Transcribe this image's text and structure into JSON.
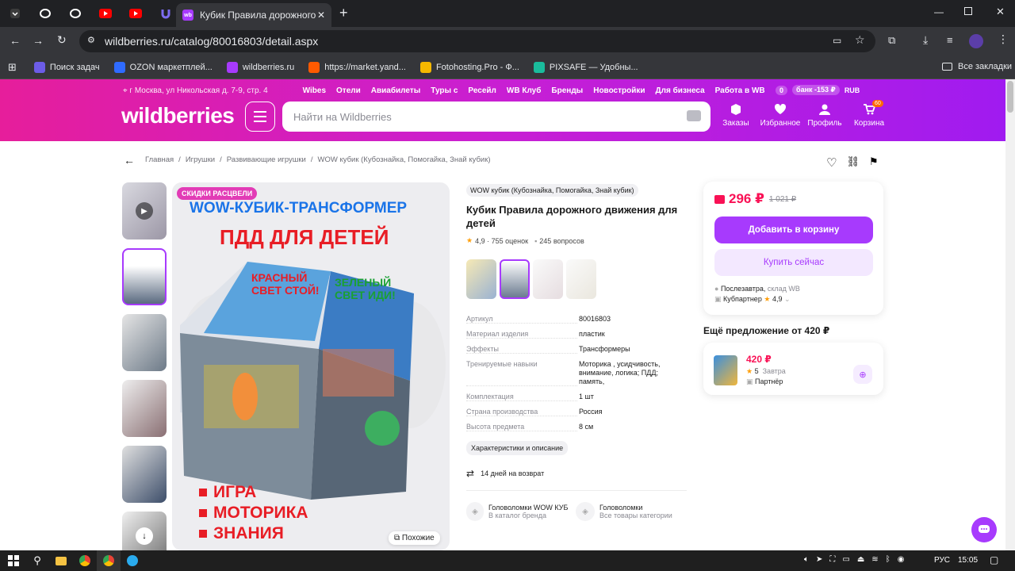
{
  "browser": {
    "active_tab_title": "Кубик Правила дорожного дв",
    "url": "wildberries.ru/catalog/80016803/detail.aspx",
    "bookmarks": [
      {
        "label": "Поиск задач",
        "color": "#6c5ce7"
      },
      {
        "label": "OZON маркетплей...",
        "color": "#2f6bff"
      },
      {
        "label": "wildberries.ru",
        "color": "#a73afd"
      },
      {
        "label": "https://market.yand...",
        "color": "#ff5a00"
      },
      {
        "label": "Fotohosting.Pro - Ф...",
        "color": "#f5b800"
      },
      {
        "label": "PIXSAFE — Удобны...",
        "color": "#1abc9c"
      }
    ],
    "all_bookmarks_label": "Все закладки"
  },
  "header": {
    "location": "г Москва, ул Никольская д. 7-9, стр. 4",
    "links": [
      "Wibes",
      "Отели",
      "Авиабилеты",
      "Туры с",
      "Ресейл",
      "WB Клуб",
      "Бренды",
      "Новостройки",
      "Для бизнеса",
      "Работа в WB"
    ],
    "balance": "0",
    "bank": "-153 ₽",
    "currency": "RUB",
    "logo": "wildberries",
    "search_placeholder": "Найти на Wildberries",
    "nav": {
      "orders": "Заказы",
      "favorites": "Избранное",
      "profile": "Профиль",
      "cart": "Корзина",
      "cart_count": "60"
    }
  },
  "breadcrumb": [
    "Главная",
    "Игрушки",
    "Развивающие игрушки",
    "WOW кубик (Кубознайка, Помогайка, Знай кубик)"
  ],
  "gallery": {
    "sale_badge": "СКИДКИ РАСЦВЕЛИ",
    "headline": "WOW-КУБИК-ТРАНСФОРМЕР",
    "subheadline": "ПДД ДЛЯ ДЕТЕЙ",
    "cube_left": "КРАСНЫЙ СВЕТ СТОЙ!",
    "cube_right": "ЗЕЛЕНЫЙ СВЕТ ИДИ!",
    "bullets": [
      "ИГРА",
      "МОТОРИКА",
      "ЗНАНИЯ"
    ],
    "similar": "Похожие"
  },
  "product": {
    "brand": "WOW кубик (Кубознайка, Помогайка, Знай кубик)",
    "title": "Кубик Правила дорожного движения для детей",
    "rating": "4,9",
    "reviews": "755 оценок",
    "questions": "245 вопросов",
    "properties": [
      {
        "key": "Артикул",
        "value": "80016803"
      },
      {
        "key": "Материал изделия",
        "value": "пластик"
      },
      {
        "key": "Эффекты",
        "value": "Трансформеры"
      },
      {
        "key": "Тренируемые навыки",
        "value": "Моторика , усидчивость, внимание, логика; ПДД; память,"
      },
      {
        "key": "Комплектация",
        "value": "1 шт"
      },
      {
        "key": "Страна производства",
        "value": "Россия"
      },
      {
        "key": "Высота предмета",
        "value": "8 см"
      }
    ],
    "chars_button": "Характеристики и описание",
    "return_text": "14 дней на возврат",
    "categories": [
      {
        "title": "Головоломки WOW КУБ",
        "sub": "В каталог бренда"
      },
      {
        "title": "Головоломки",
        "sub": "Все товары категории"
      }
    ]
  },
  "buybox": {
    "price": "296 ₽",
    "old_price": "1 021 ₽",
    "add_to_cart": "Добавить в корзину",
    "buy_now": "Купить сейчас",
    "delivery": "Послезавтра,",
    "warehouse": "склад WB",
    "seller": "Кубпартнер",
    "seller_rating": "4,9"
  },
  "other_offer": {
    "title": "Ещё предложение от 420 ₽",
    "price": "420 ₽",
    "rating": "5",
    "delivery": "Завтра",
    "seller": "Партнёр"
  },
  "taskbar": {
    "lang": "РУС",
    "time": "15:05"
  }
}
